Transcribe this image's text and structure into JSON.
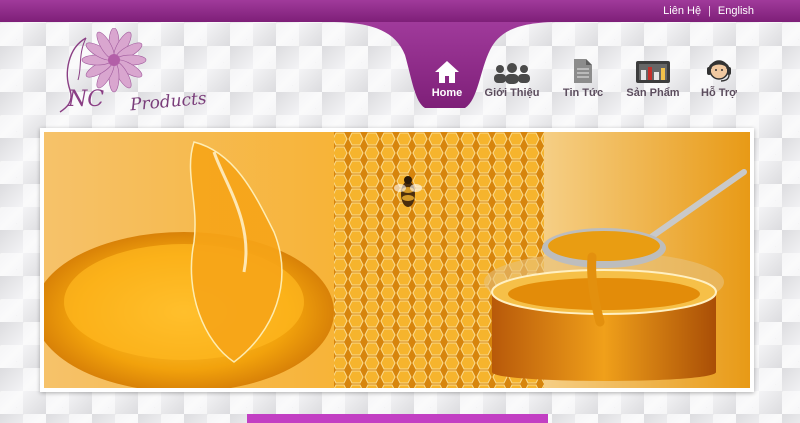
{
  "top_links": {
    "contact": "Liên Hệ",
    "separator": "|",
    "language": "English"
  },
  "brand": {
    "logo_text": "Products",
    "logo_initials": "NC"
  },
  "nav": {
    "items": [
      {
        "label": "Home",
        "icon": "home-icon",
        "active": true
      },
      {
        "label": "Giới Thiệu",
        "icon": "people-icon",
        "active": false
      },
      {
        "label": "Tin Tức",
        "icon": "document-icon",
        "active": false
      },
      {
        "label": "Sản Phẩm",
        "icon": "products-icon",
        "active": false
      },
      {
        "label": "Hỗ Trợ",
        "icon": "support-icon",
        "active": false
      }
    ]
  },
  "banner": {
    "image": "honey-banner",
    "description_alt": ""
  },
  "colors": {
    "brand_purple": "#9b2f96",
    "brand_light_purple": "#c74dbd",
    "accent_bar": "#c23fc3",
    "nav_text": "#5c4d5e",
    "honey": "#f2a20c"
  }
}
